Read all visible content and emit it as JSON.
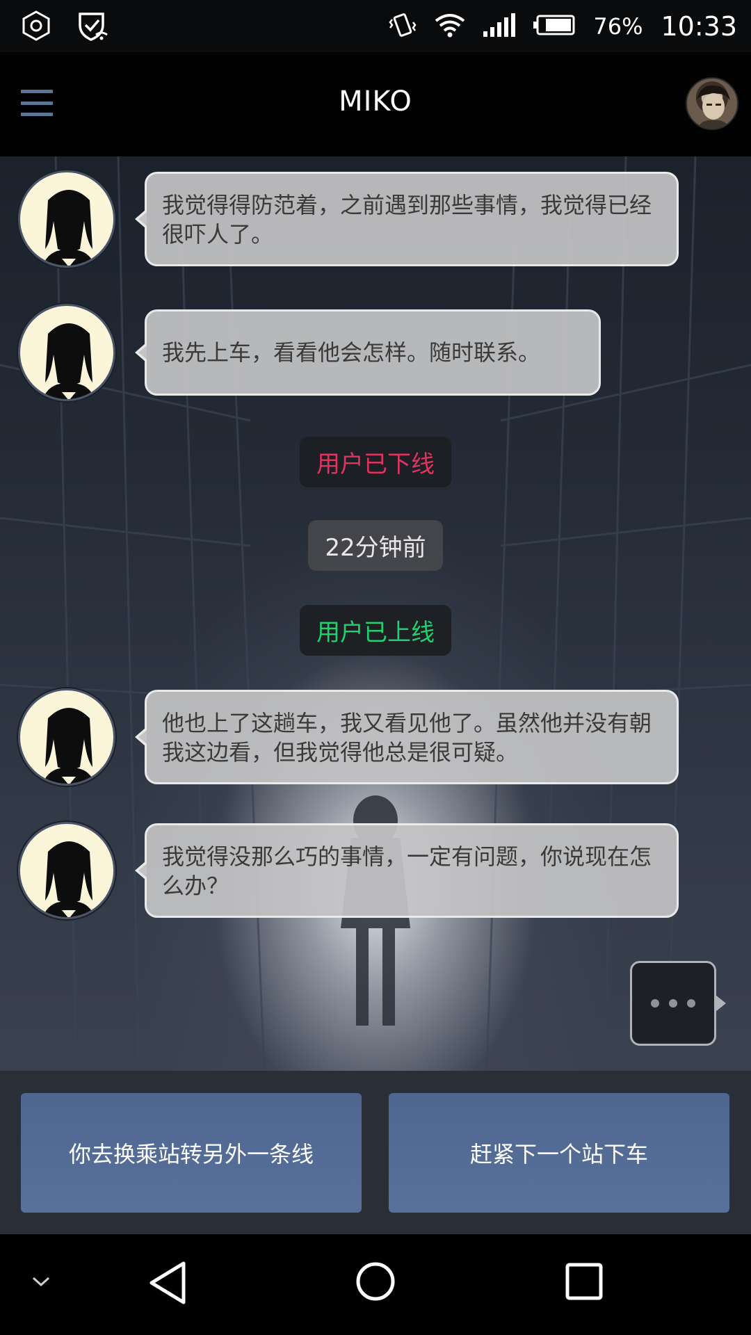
{
  "status_bar": {
    "battery": "76%",
    "time": "10:33",
    "icons": [
      "hexagon-icon",
      "shield-wifi-icon",
      "vibrate-icon",
      "wifi-icon",
      "signal-icon",
      "battery-icon"
    ]
  },
  "app_bar": {
    "title": "MIKO",
    "menu_icon": "hamburger-menu-icon",
    "profile_icon": "profile-avatar"
  },
  "messages": [
    {
      "sender": "contact",
      "text": "我觉得得防范着，之前遇到那些事情，我觉得已经很吓人了。"
    },
    {
      "sender": "contact",
      "text": "我先上车，看看他会怎样。随时联系。"
    },
    {
      "sender": "contact",
      "text": "他也上了这趟车，我又看见他了。虽然他并没有朝我这边看，但我觉得他总是很可疑。"
    },
    {
      "sender": "contact",
      "text": "我觉得没那么巧的事情，一定有问题，你说现在怎么办？"
    }
  ],
  "system_notices": {
    "offline": "用户已下线",
    "elapsed": "22分钟前",
    "online": "用户已上线"
  },
  "colors": {
    "offline": "#e0335f",
    "online": "#21d16f",
    "choice_button": "#56709a",
    "menu_icon": "#5b7596"
  },
  "choices": [
    {
      "label": "你去换乘站转另外一条线"
    },
    {
      "label": "赶紧下一个站下车"
    }
  ],
  "nav_bar": {
    "icons": [
      "chevron-down-icon",
      "back-icon",
      "home-icon",
      "recents-icon"
    ]
  }
}
